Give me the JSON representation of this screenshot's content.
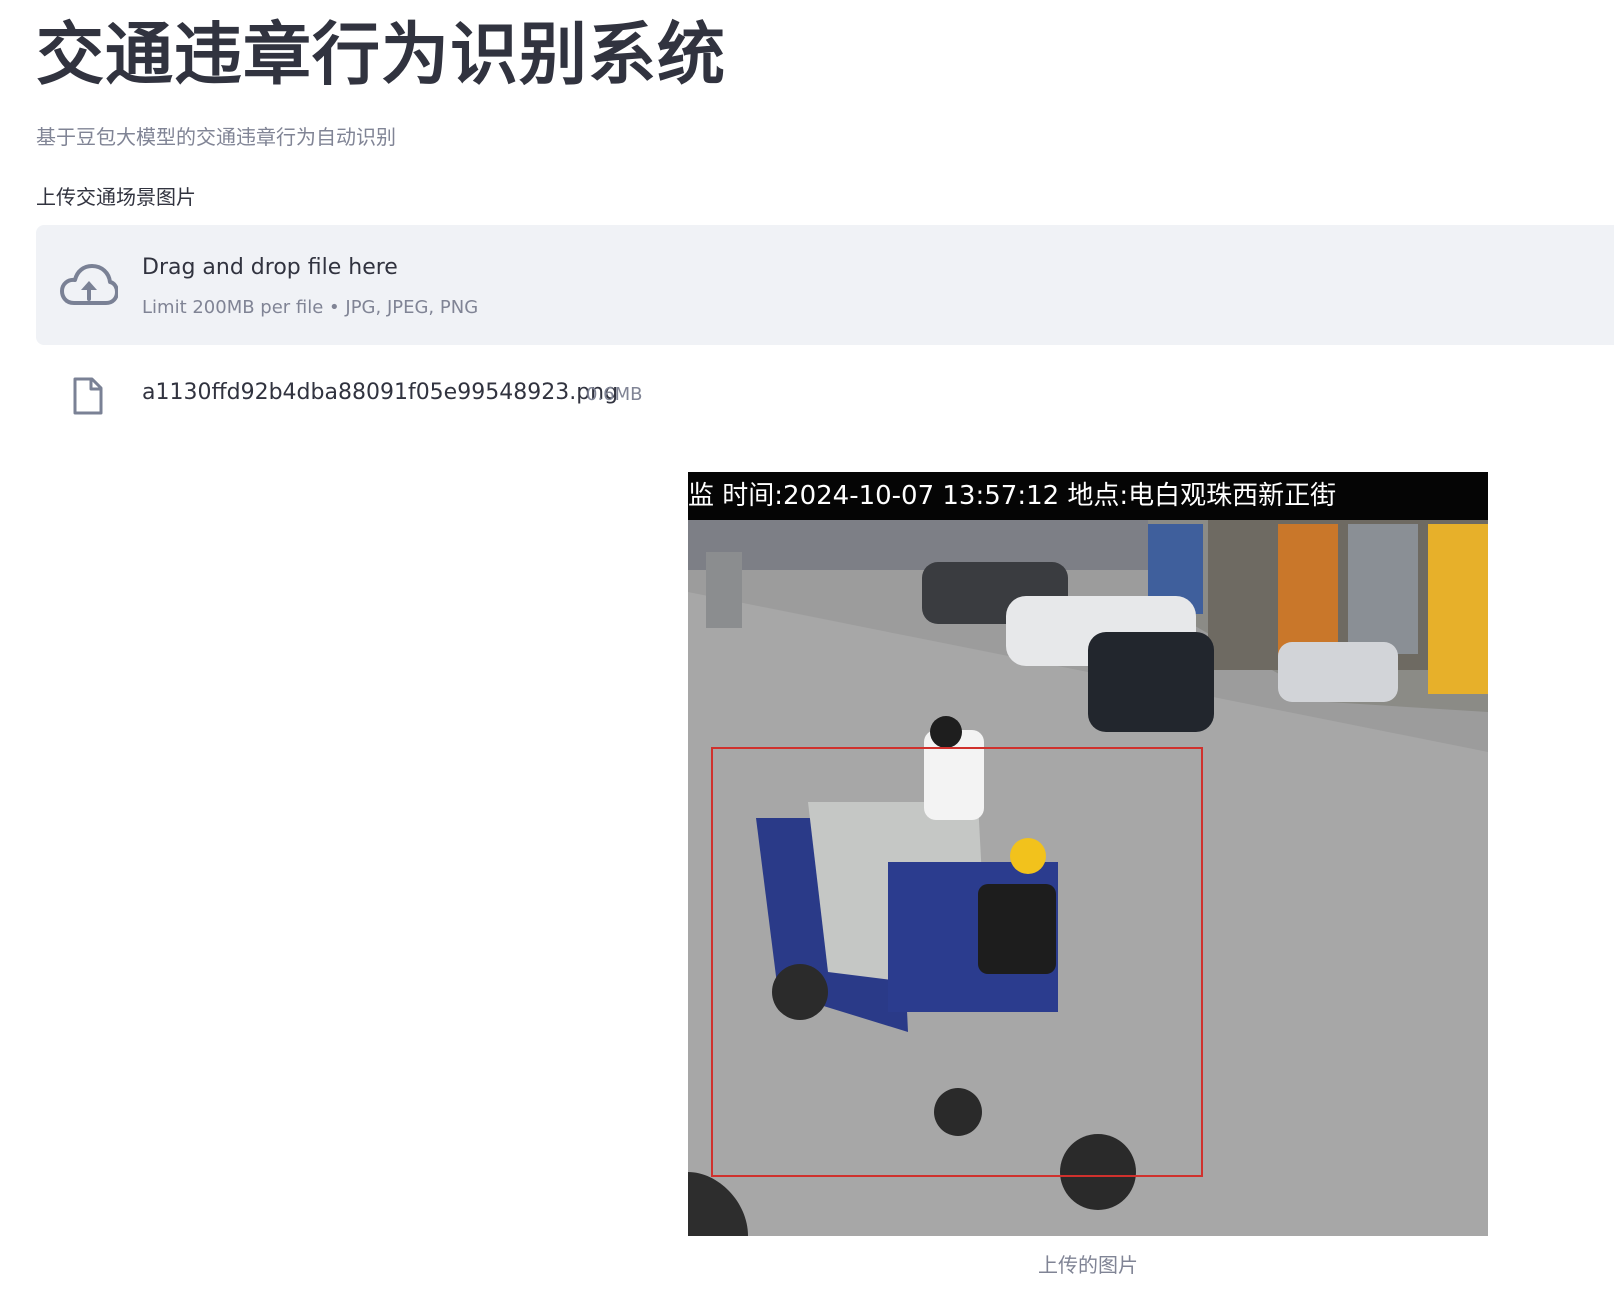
{
  "header": {
    "title": "交通违章行为识别系统",
    "subtitle": "基于豆包大模型的交通违章行为自动识别"
  },
  "uploader": {
    "label": "上传交通场景图片",
    "drop_text": "Drag and drop file here",
    "limit_text": "Limit 200MB per file • JPG, JPEG, PNG",
    "icon": "cloud-upload-icon"
  },
  "uploaded_file": {
    "name": "a1130ffd92b4dba88091f05e99548923.png",
    "size": "0.6MB",
    "icon": "file-icon"
  },
  "image": {
    "overlay_text": "监 时间:2024-10-07 13:57:12 地点:电白观珠西新正街",
    "caption": "上传的图片",
    "detection_box_color": "#d0312d"
  },
  "colors": {
    "text_primary": "#31333f",
    "text_secondary": "#808495",
    "dropzone_bg": "#f0f2f6"
  }
}
